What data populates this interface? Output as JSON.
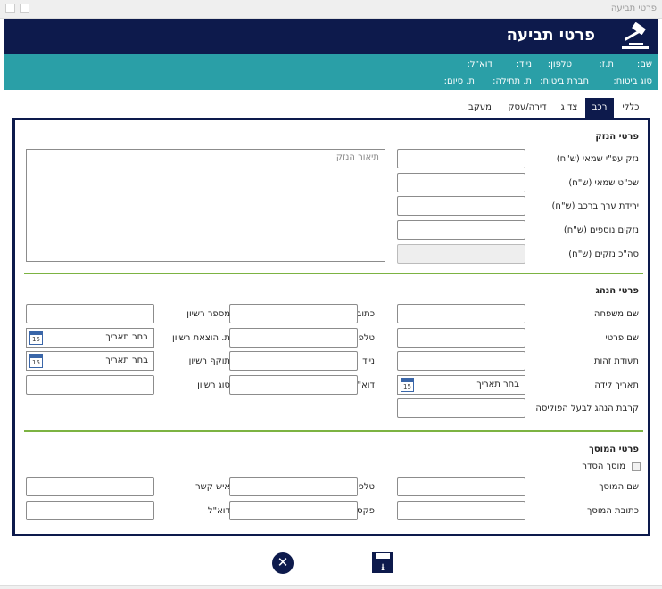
{
  "window": {
    "title": "פרטי תביעה"
  },
  "header": {
    "title": "פרטי תביעה",
    "icon": "gavel-icon"
  },
  "info": {
    "name_label": "שם:",
    "id_label": "ת.ז:",
    "phone_label": "טלפון:",
    "mobile_label": "נייד:",
    "email_label": "דוא\"ל:",
    "insurance_type_label": "סוג ביטוח:",
    "insurance_company_label": "חברת ביטוח:",
    "start_date_label": "ת. תחילה:",
    "end_date_label": "ת. סיום:"
  },
  "tabs": [
    "כללי",
    "רכב",
    "צד ג",
    "דירה/עסק",
    "מעקב"
  ],
  "active_tab": "רכב",
  "damage": {
    "section_title": "פרטי הנזק",
    "appraiser_damage_label": "נזק עפ\"י שמאי (ש\"ח)",
    "appraiser_fee_label": "שכ\"ט שמאי (ש\"ח)",
    "depreciation_label": "ירידת ערך ברכב (ש\"ח)",
    "additional_damage_label": "נזקים נוספים (ש\"ח)",
    "total_damage_label": "סה\"כ נזקים (ש\"ח)",
    "description_placeholder": "תיאור הנזק"
  },
  "driver": {
    "section_title": "פרטי הנהג",
    "last_name_label": "שם משפחה",
    "first_name_label": "שם פרטי",
    "id_label": "תעודת זהות",
    "birth_date_label": "תאריך לידה",
    "relation_label": "קרבת הנהג לבעל הפוליסה",
    "address_label": "כתובת",
    "phone_label": "טלפון",
    "mobile_label": "נייד",
    "email_label": "דוא\"ל",
    "license_number_label": "מספר רשיון",
    "license_issue_label": "ת. הוצאת רשיון",
    "license_expiry_label": "תוקף רשיון",
    "license_type_label": "סוג רשיון",
    "date_placeholder": "בחר תאריך",
    "calendar_day": "15"
  },
  "garage": {
    "section_title": "פרטי המוסך",
    "approved_label": "מוסך הסדר",
    "name_label": "שם המוסך",
    "address_label": "כתובת המוסך",
    "phone_label": "טלפון",
    "fax_label": "פקס",
    "contact_label": "איש קשר",
    "email_label": "דוא\"ל"
  },
  "actions": {
    "close_icon": "✕",
    "save_icon": "⭳"
  },
  "colors": {
    "navy": "#0d1a4c",
    "teal": "#2a9fa7",
    "green_divider": "#7cb342"
  }
}
